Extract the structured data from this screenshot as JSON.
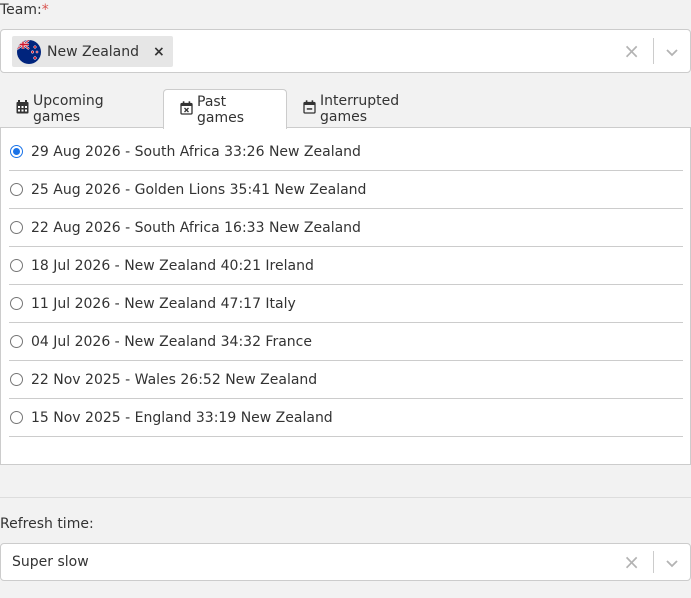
{
  "team": {
    "label": "Team:",
    "required_mark": "*",
    "selected": "New Zealand",
    "remove_glyph": "×",
    "clear_glyph": "×"
  },
  "tabs": [
    {
      "label": "Upcoming games",
      "icon": "calendar-icon",
      "active": false
    },
    {
      "label": "Past games",
      "icon": "calendar-x-icon",
      "active": true
    },
    {
      "label": "Interrupted games",
      "icon": "calendar-minus-icon",
      "active": false
    }
  ],
  "games": [
    {
      "label": "29 Aug 2026 - South Africa 33:26 New Zealand",
      "selected": true
    },
    {
      "label": "25 Aug 2026 - Golden Lions 35:41 New Zealand",
      "selected": false
    },
    {
      "label": "22 Aug 2026 - South Africa 16:33 New Zealand",
      "selected": false
    },
    {
      "label": "18 Jul 2026 - New Zealand 40:21 Ireland",
      "selected": false
    },
    {
      "label": "11 Jul 2026 - New Zealand 47:17 Italy",
      "selected": false
    },
    {
      "label": "04 Jul 2026 - New Zealand 34:32 France",
      "selected": false
    },
    {
      "label": "22 Nov 2025 - Wales 26:52 New Zealand",
      "selected": false
    },
    {
      "label": "15 Nov 2025 - England 33:19 New Zealand",
      "selected": false
    }
  ],
  "refresh": {
    "label": "Refresh time:",
    "selected": "Super slow",
    "clear_glyph": "×"
  },
  "colors": {
    "accent": "#1a73e8",
    "border": "#cccccc",
    "required": "#d9534f"
  }
}
